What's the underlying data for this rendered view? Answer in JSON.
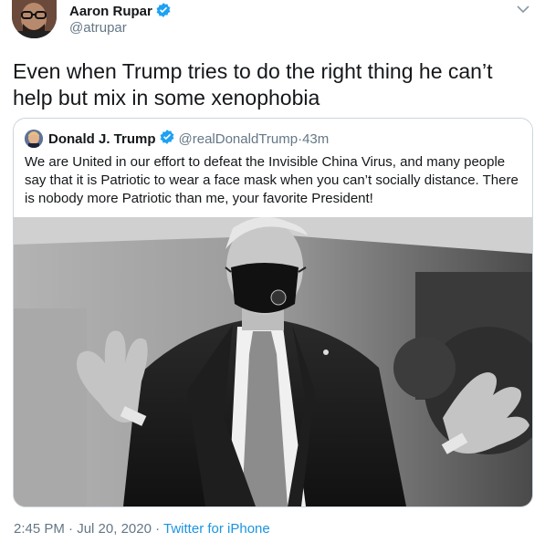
{
  "author": {
    "name": "Aaron Rupar",
    "handle": "@atrupar"
  },
  "tweet": {
    "text": "Even when Trump tries to do the right thing he can’t help but mix in some xenophobia"
  },
  "quote": {
    "name": "Donald J. Trump",
    "handle": "@realDonaldTrump",
    "separator": " · ",
    "time": "43m",
    "text": "We are United in our effort to defeat the Invisible China Virus, and many people say that it is Patriotic to wear a face mask when you can’t socially distance. There is nobody more Patriotic than me, your favorite President!"
  },
  "meta": {
    "time": "2:45 PM",
    "separator1": " · ",
    "date": "Jul 20, 2020",
    "separator2": " · ",
    "app": "Twitter for iPhone"
  },
  "icons": {
    "verified": "verified-badge-icon",
    "caret": "chevron-down-icon"
  },
  "colors": {
    "accent": "#1b95e0",
    "verified": "#1da1f2",
    "secondary_text": "#657786",
    "border": "#ccd6dd"
  }
}
